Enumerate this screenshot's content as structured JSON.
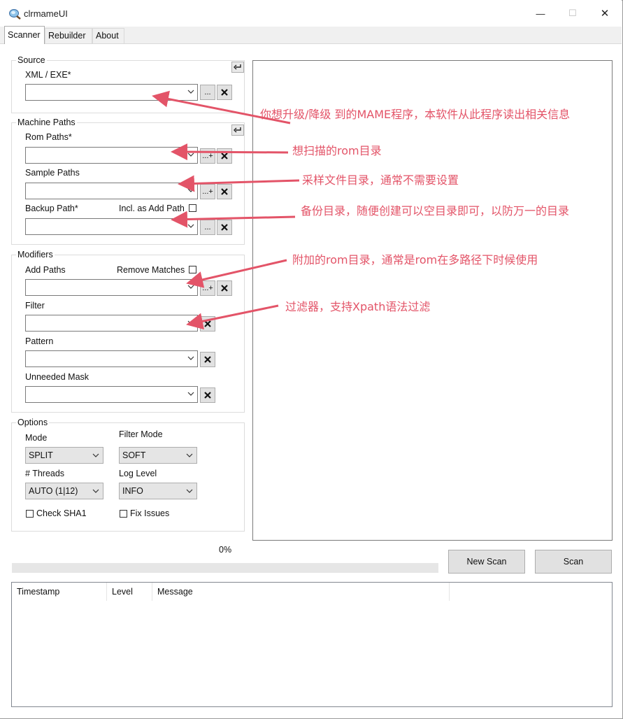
{
  "window": {
    "title": "clrmameUI",
    "controls": {
      "minimize": "—",
      "maximize": "☐",
      "close": "✕"
    }
  },
  "tabs": [
    {
      "label": "Scanner",
      "active": true
    },
    {
      "label": "Rebuilder",
      "active": false
    },
    {
      "label": "About",
      "active": false
    }
  ],
  "source": {
    "group_title": "Source",
    "xml_label": "XML / EXE*",
    "xml_value": "",
    "browse_label": "..."
  },
  "machine_paths": {
    "group_title": "Machine Paths",
    "rom_label": "Rom Paths*",
    "rom_value": "",
    "sample_label": "Sample Paths",
    "sample_value": "",
    "backup_label": "Backup Path*",
    "backup_value": "",
    "incl_add_path_label": "Incl. as Add Path",
    "incl_add_path_checked": false,
    "add_browse_label": "...+",
    "browse_label": "..."
  },
  "modifiers": {
    "group_title": "Modifiers",
    "add_paths_label": "Add Paths",
    "add_paths_value": "",
    "remove_matches_label": "Remove Matches",
    "remove_matches_checked": false,
    "filter_label": "Filter",
    "filter_value": "",
    "pattern_label": "Pattern",
    "pattern_value": "",
    "unneeded_label": "Unneeded Mask",
    "unneeded_value": "",
    "add_browse_label": "...+"
  },
  "options": {
    "group_title": "Options",
    "mode_label": "Mode",
    "mode_value": "SPLIT",
    "filter_mode_label": "Filter Mode",
    "filter_mode_value": "SOFT",
    "threads_label": "# Threads",
    "threads_value": "AUTO (1|12)",
    "log_level_label": "Log Level",
    "log_level_value": "INFO",
    "check_sha1_label": "Check SHA1",
    "check_sha1_checked": false,
    "fix_issues_label": "Fix Issues",
    "fix_issues_checked": false
  },
  "progress": {
    "text": "0%",
    "value": 0
  },
  "buttons": {
    "new_scan": "New Scan",
    "scan": "Scan"
  },
  "log": {
    "columns": [
      "Timestamp",
      "Level",
      "Message"
    ],
    "rows": []
  },
  "annotations": {
    "color": "#e35468",
    "xml": "你想升级/降级 到的MAME程序，本软件从此程序读出相关信息",
    "rom": "想扫描的rom目录",
    "sample": "采样文件目录，通常不需要设置",
    "backup": "备份目录，随便创建可以空目录即可，以防万一的目录",
    "add_paths": "附加的rom目录，通常是rom在多路径下时候使用",
    "filter": "过滤器，支持Xpath语法过滤"
  },
  "icons": {
    "app": "magnifier-disc-icon",
    "chevron": "chevron-down-icon",
    "clear": "x-clear-icon",
    "undo": "return-arrow-icon"
  }
}
